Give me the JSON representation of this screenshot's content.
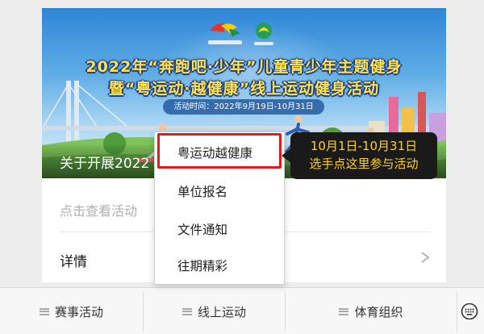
{
  "article": {
    "banner": {
      "title_line1": "2022年“奔跑吧·少年”儿童青少年主题健身",
      "title_line2": "暨“粤运动·越健康”线上运动健身活动",
      "date": "活动时间：2022年9月19日-10月31日",
      "caption": "关于开展2022"
    },
    "summary": "点击查看活动",
    "detail_label": "详情"
  },
  "popup_menu": {
    "items": [
      "粤运动越健康",
      "单位报名",
      "文件通知",
      "往期精彩"
    ],
    "highlight_color": "#e01b1b"
  },
  "callout": {
    "line1": "10月1日-10月31日",
    "line2": "选手点这里参与活动",
    "text_color": "#ffd21c"
  },
  "menubar": {
    "items": [
      "赛事活动",
      "线上运动",
      "体育组织"
    ],
    "keyboard_icon": "keyboard-icon"
  }
}
